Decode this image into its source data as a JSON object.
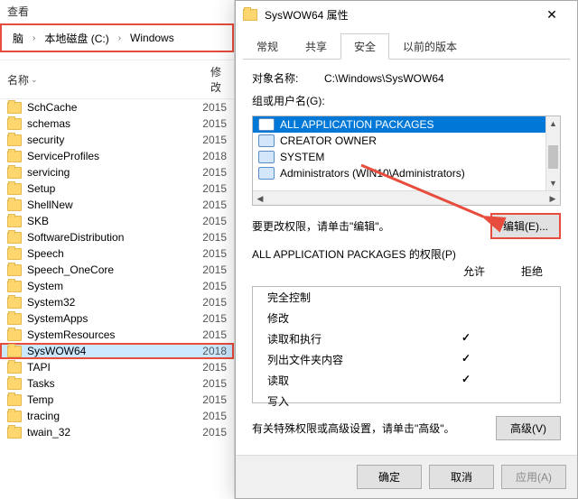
{
  "explorer": {
    "view_label": "查看",
    "breadcrumb": {
      "parent_prefix": "脑",
      "disk": "本地磁盘 (C:)",
      "folder": "Windows"
    },
    "columns": {
      "name": "名称",
      "date": "修改"
    },
    "items": [
      {
        "name": "SchCache",
        "date": "2015"
      },
      {
        "name": "schemas",
        "date": "2015"
      },
      {
        "name": "security",
        "date": "2015"
      },
      {
        "name": "ServiceProfiles",
        "date": "2018"
      },
      {
        "name": "servicing",
        "date": "2015"
      },
      {
        "name": "Setup",
        "date": "2015"
      },
      {
        "name": "ShellNew",
        "date": "2015"
      },
      {
        "name": "SKB",
        "date": "2015"
      },
      {
        "name": "SoftwareDistribution",
        "date": "2015"
      },
      {
        "name": "Speech",
        "date": "2015"
      },
      {
        "name": "Speech_OneCore",
        "date": "2015"
      },
      {
        "name": "System",
        "date": "2015"
      },
      {
        "name": "System32",
        "date": "2015"
      },
      {
        "name": "SystemApps",
        "date": "2015"
      },
      {
        "name": "SystemResources",
        "date": "2015"
      },
      {
        "name": "SysWOW64",
        "date": "2018",
        "highlight": true,
        "selected": true
      },
      {
        "name": "TAPI",
        "date": "2015"
      },
      {
        "name": "Tasks",
        "date": "2015"
      },
      {
        "name": "Temp",
        "date": "2015"
      },
      {
        "name": "tracing",
        "date": "2015"
      },
      {
        "name": "twain_32",
        "date": "2015"
      }
    ]
  },
  "dialog": {
    "title": "SysWOW64 属性",
    "tabs": [
      "常规",
      "共享",
      "安全",
      "以前的版本"
    ],
    "active_tab": "安全",
    "object_label": "对象名称:",
    "object_value": "C:\\Windows\\SysWOW64",
    "groups_label": "组或用户名(G):",
    "groups": [
      {
        "name": "ALL APPLICATION PACKAGES",
        "selected": true,
        "type": "pkg"
      },
      {
        "name": "CREATOR OWNER",
        "type": "user"
      },
      {
        "name": "SYSTEM",
        "type": "user"
      },
      {
        "name": "Administrators (WIN10\\Administrators)",
        "type": "user"
      }
    ],
    "edit_hint": "要更改权限，请单击\"编辑\"。",
    "edit_btn": "编辑(E)...",
    "perm_title_prefix": "ALL APPLICATION PACKAGES",
    "perm_title_suffix": "的权限(P)",
    "allow": "允许",
    "deny": "拒绝",
    "permissions": [
      {
        "name": "完全控制",
        "allow": false,
        "deny": false
      },
      {
        "name": "修改",
        "allow": false,
        "deny": false
      },
      {
        "name": "读取和执行",
        "allow": true,
        "deny": false
      },
      {
        "name": "列出文件夹内容",
        "allow": true,
        "deny": false
      },
      {
        "name": "读取",
        "allow": true,
        "deny": false
      },
      {
        "name": "写入",
        "allow": false,
        "deny": false
      }
    ],
    "advanced_hint": "有关特殊权限或高级设置，请单击\"高级\"。",
    "advanced_btn": "高级(V)",
    "buttons": {
      "ok": "确定",
      "cancel": "取消",
      "apply": "应用(A)"
    }
  }
}
